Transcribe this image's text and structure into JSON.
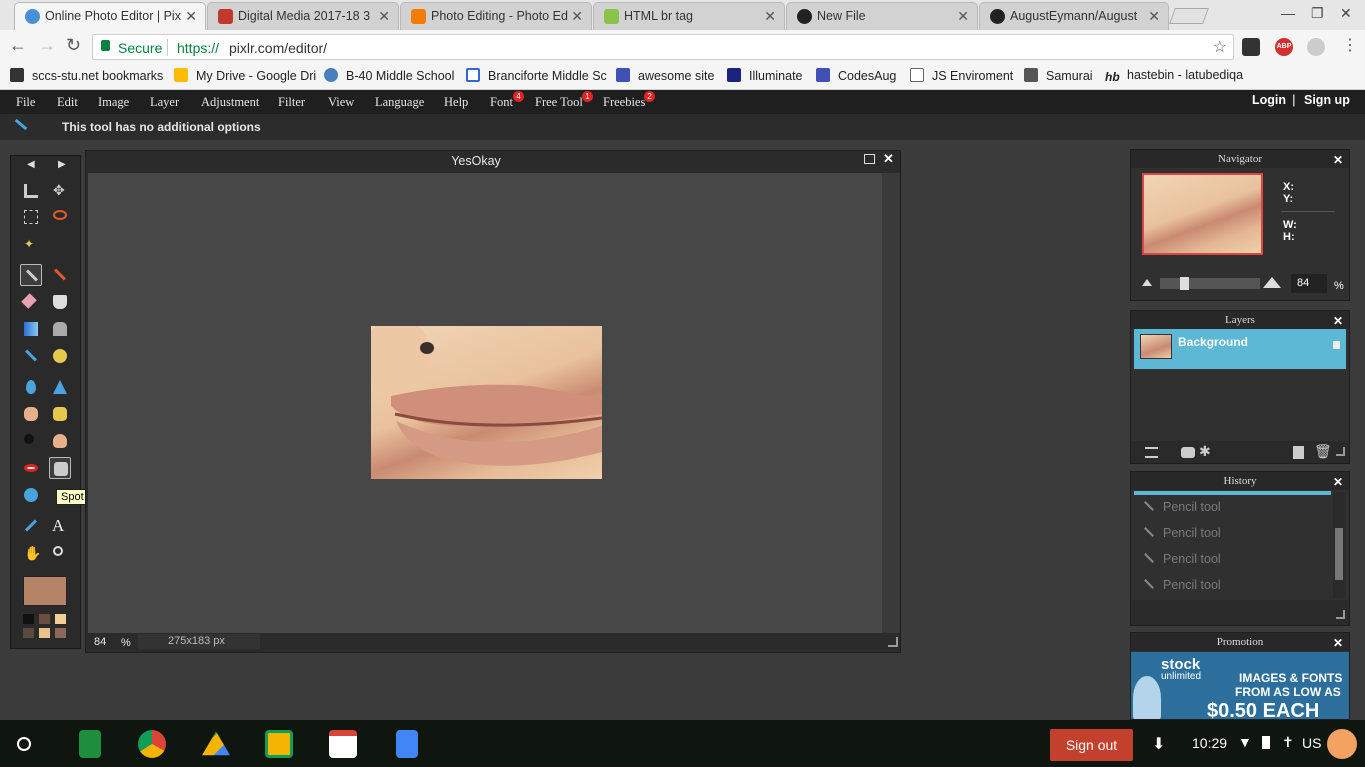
{
  "browser": {
    "tabs": [
      {
        "label": "Online Photo Editor | Pix",
        "color": "#4a90d9",
        "active": true
      },
      {
        "label": "Digital Media 2017-18 3",
        "color": "#c0392b",
        "active": false
      },
      {
        "label": "Photo Editing - Photo Ed",
        "color": "#f57c00",
        "active": false
      },
      {
        "label": "HTML br tag",
        "color": "#8bc34a",
        "active": false
      },
      {
        "label": "New File",
        "color": "#222222",
        "active": false
      },
      {
        "label": "AugustEymann/August",
        "color": "#222222",
        "active": false
      }
    ],
    "secure_label": "Secure",
    "url_protocol": "https://",
    "url_rest": "pixlr.com/editor/",
    "bookmarks": [
      {
        "label": "sccs-stu.net bookmarks",
        "color": "#333333"
      },
      {
        "label": "My Drive - Google Dri",
        "color": "#fbbc05"
      },
      {
        "label": "B-40 Middle School",
        "color": "#4a7fbf"
      },
      {
        "label": "Branciforte Middle Sc",
        "color": "#3367d6"
      },
      {
        "label": "awesome site",
        "color": "#3f51b5"
      },
      {
        "label": "Illuminate",
        "color": "#1a237e"
      },
      {
        "label": "CodesAug",
        "color": "#3f51b5"
      },
      {
        "label": "JS Enviroment",
        "color": "#ffffff"
      },
      {
        "label": "Samurai",
        "color": "#555555"
      },
      {
        "label": "hastebin - latubediqa",
        "color": "#222222"
      }
    ]
  },
  "pixlr": {
    "menu": [
      {
        "label": "File"
      },
      {
        "label": "Edit"
      },
      {
        "label": "Image"
      },
      {
        "label": "Layer"
      },
      {
        "label": "Adjustment"
      },
      {
        "label": "Filter"
      },
      {
        "label": "View"
      },
      {
        "label": "Language"
      },
      {
        "label": "Help"
      },
      {
        "label": "Font",
        "badge": "4"
      },
      {
        "label": "Free Tool",
        "badge": "1"
      },
      {
        "label": "Freebies",
        "badge": "2"
      }
    ],
    "login": "Login",
    "signup": "Sign up",
    "options_text": "This tool has no additional options",
    "tooltip": "Spot heal tool (F)",
    "primary_color": "#b58467",
    "document": {
      "title": "YesOkay",
      "zoom": "84",
      "zoom_unit": "%",
      "size": "275x183 px"
    },
    "navigator": {
      "title": "Navigator",
      "x_label": "X:",
      "y_label": "Y:",
      "w_label": "W:",
      "h_label": "H:",
      "zoom": "84",
      "zoom_unit": "%"
    },
    "layers": {
      "title": "Layers",
      "items": [
        {
          "name": "Background"
        }
      ]
    },
    "history": {
      "title": "History",
      "items": [
        "Pencil tool",
        "Pencil tool",
        "Pencil tool",
        "Pencil tool"
      ]
    },
    "promotion": {
      "title": "Promotion",
      "brand": "stock",
      "brand_sub": "unlimited",
      "line1": "IMAGES & FONTS",
      "line2": "FROM AS LOW AS",
      "line3": "$0.50 EACH"
    }
  },
  "shelf": {
    "sign_out": "Sign out",
    "time": "10:29",
    "locale": "US"
  }
}
